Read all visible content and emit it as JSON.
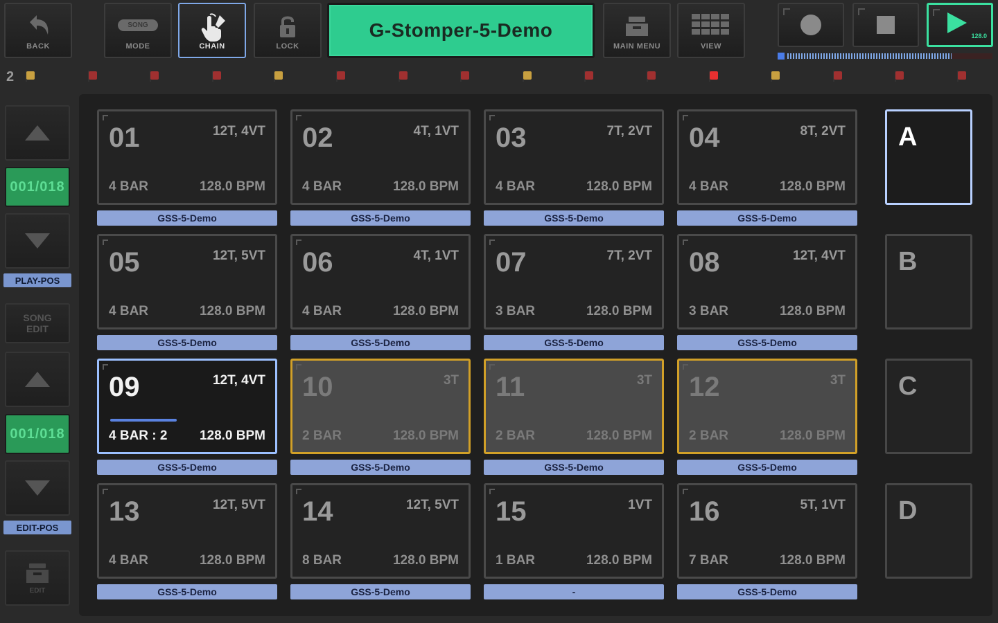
{
  "toolbar": {
    "back_label": "BACK",
    "mode_label": "MODE",
    "mode_badge": "SONG",
    "chain_label": "CHAIN",
    "lock_label": "LOCK",
    "title": "G-Stomper-5-Demo",
    "main_menu_label": "MAIN MENU",
    "view_label": "VIEW",
    "tempo": "128.0"
  },
  "transport": {
    "progress": 0.8
  },
  "flag_row": {
    "index": "2",
    "flags": [
      {
        "color": "#c8a040"
      },
      {
        "color": "#a03030"
      },
      {
        "color": "#a03030"
      },
      {
        "color": "#a03030"
      },
      {
        "color": "#c8a040"
      },
      {
        "color": "#a03030"
      },
      {
        "color": "#a03030"
      },
      {
        "color": "#a03030"
      },
      {
        "color": "#c8a040"
      },
      {
        "color": "#a03030"
      },
      {
        "color": "#a03030"
      },
      {
        "color": "#e83030"
      },
      {
        "color": "#c8a040"
      },
      {
        "color": "#a03030"
      },
      {
        "color": "#a03030"
      },
      {
        "color": "#a03030"
      }
    ]
  },
  "sidebar": {
    "play_pos": "001/018",
    "play_pos_label": "PLAY-POS",
    "song_edit_line1": "SONG",
    "song_edit_line2": "EDIT",
    "edit_pos": "001/018",
    "edit_pos_label": "EDIT-POS",
    "edit_label": "EDIT"
  },
  "pads": [
    {
      "num": "01",
      "tracks": "12T, 4VT",
      "bars": "4 BAR",
      "bpm": "128.0 BPM",
      "label": "GSS-5-Demo"
    },
    {
      "num": "02",
      "tracks": "4T, 1VT",
      "bars": "4 BAR",
      "bpm": "128.0 BPM",
      "label": "GSS-5-Demo"
    },
    {
      "num": "03",
      "tracks": "7T, 2VT",
      "bars": "4 BAR",
      "bpm": "128.0 BPM",
      "label": "GSS-5-Demo"
    },
    {
      "num": "04",
      "tracks": "8T, 2VT",
      "bars": "4 BAR",
      "bpm": "128.0 BPM",
      "label": "GSS-5-Demo"
    },
    {
      "num": "05",
      "tracks": "12T, 5VT",
      "bars": "4 BAR",
      "bpm": "128.0 BPM",
      "label": "GSS-5-Demo"
    },
    {
      "num": "06",
      "tracks": "4T, 1VT",
      "bars": "4 BAR",
      "bpm": "128.0 BPM",
      "label": "GSS-5-Demo"
    },
    {
      "num": "07",
      "tracks": "7T, 2VT",
      "bars": "3 BAR",
      "bpm": "128.0 BPM",
      "label": "GSS-5-Demo"
    },
    {
      "num": "08",
      "tracks": "12T, 4VT",
      "bars": "3 BAR",
      "bpm": "128.0 BPM",
      "label": "GSS-5-Demo"
    },
    {
      "num": "09",
      "tracks": "12T, 4VT",
      "bars": "4 BAR : 2",
      "bpm": "128.0 BPM",
      "label": "GSS-5-Demo",
      "state": "playing",
      "progress": 0.4
    },
    {
      "num": "10",
      "tracks": "3T",
      "bars": "2 BAR",
      "bpm": "128.0 BPM",
      "label": "GSS-5-Demo",
      "state": "queued"
    },
    {
      "num": "11",
      "tracks": "3T",
      "bars": "2 BAR",
      "bpm": "128.0 BPM",
      "label": "GSS-5-Demo",
      "state": "queued"
    },
    {
      "num": "12",
      "tracks": "3T",
      "bars": "2 BAR",
      "bpm": "128.0 BPM",
      "label": "GSS-5-Demo",
      "state": "queued"
    },
    {
      "num": "13",
      "tracks": "12T, 5VT",
      "bars": "4 BAR",
      "bpm": "128.0 BPM",
      "label": "GSS-5-Demo"
    },
    {
      "num": "14",
      "tracks": "12T, 5VT",
      "bars": "8 BAR",
      "bpm": "128.0 BPM",
      "label": "GSS-5-Demo"
    },
    {
      "num": "15",
      "tracks": "1VT",
      "bars": "1 BAR",
      "bpm": "128.0 BPM",
      "label": "-"
    },
    {
      "num": "16",
      "tracks": "5T, 1VT",
      "bars": "7 BAR",
      "bpm": "128.0 BPM",
      "label": "GSS-5-Demo"
    }
  ],
  "banks": [
    {
      "letter": "A",
      "active": true
    },
    {
      "letter": "B"
    },
    {
      "letter": "C"
    },
    {
      "letter": "D"
    }
  ]
}
